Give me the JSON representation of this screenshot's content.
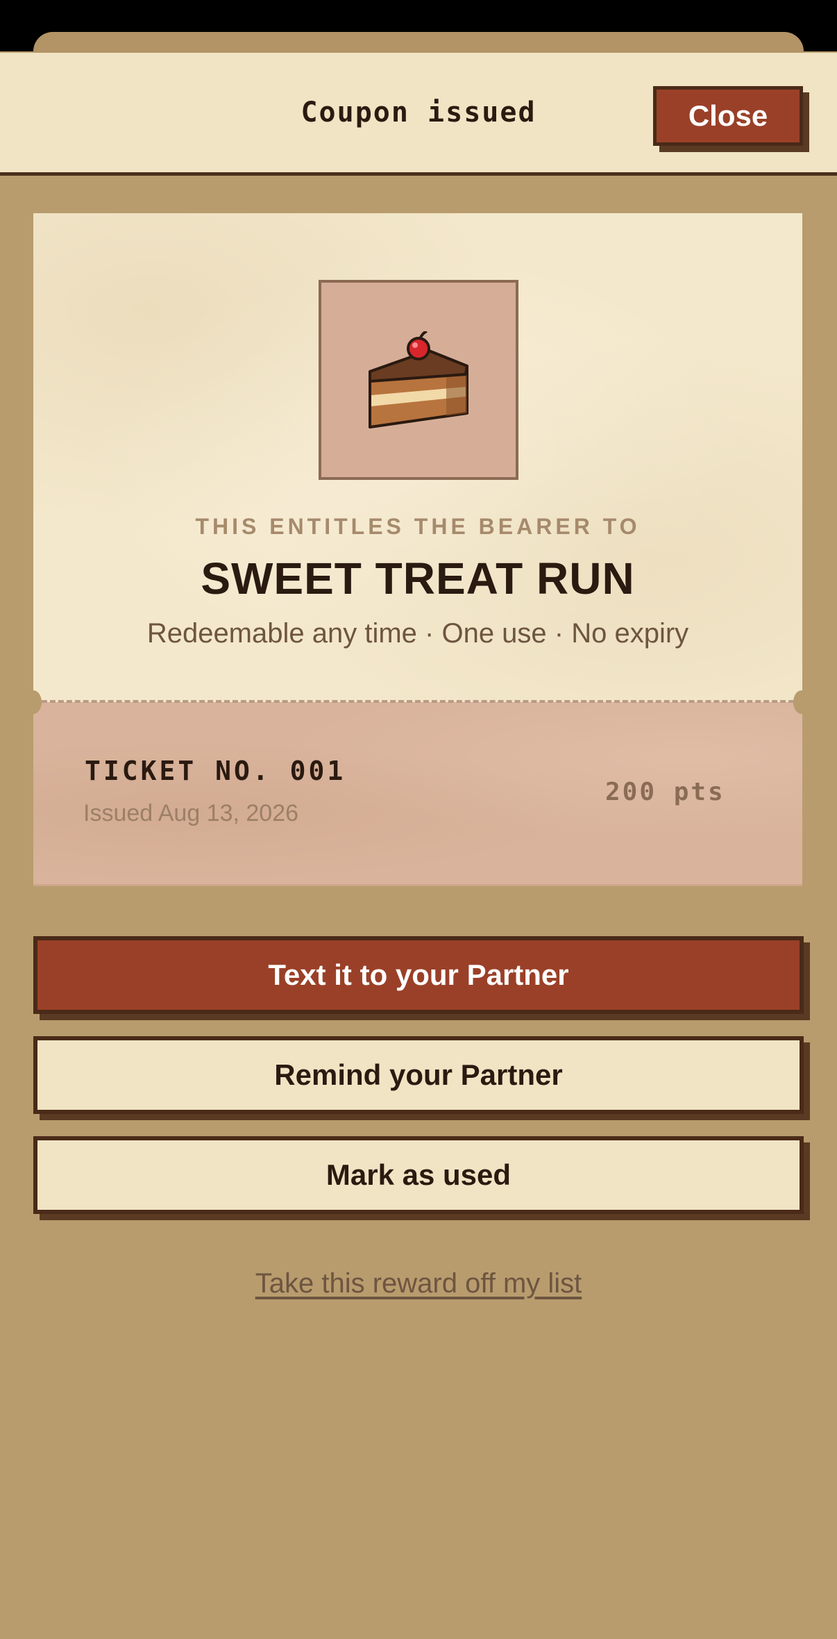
{
  "header": {
    "title": "Coupon issued",
    "close_label": "Close"
  },
  "coupon": {
    "icon": "cake-slice-icon",
    "entitles_text": "THIS ENTITLES THE BEARER TO",
    "reward_title": "SWEET TREAT RUN",
    "reward_terms": "Redeemable any time · One use · No expiry",
    "ticket_number": "TICKET NO. 001",
    "issued_date": "Issued Aug 13, 2026",
    "points": "200 pts"
  },
  "actions": {
    "text_partner_label": "Text it to your Partner",
    "remind_partner_label": "Remind your Partner",
    "mark_used_label": "Mark as used",
    "remove_link_label": "Take this reward off my list"
  },
  "colors": {
    "background": "#b89c6e",
    "paper": "#f4e8cc",
    "stub": "#d9b39b",
    "accent": "#9a4028",
    "ink": "#2a1a10"
  }
}
